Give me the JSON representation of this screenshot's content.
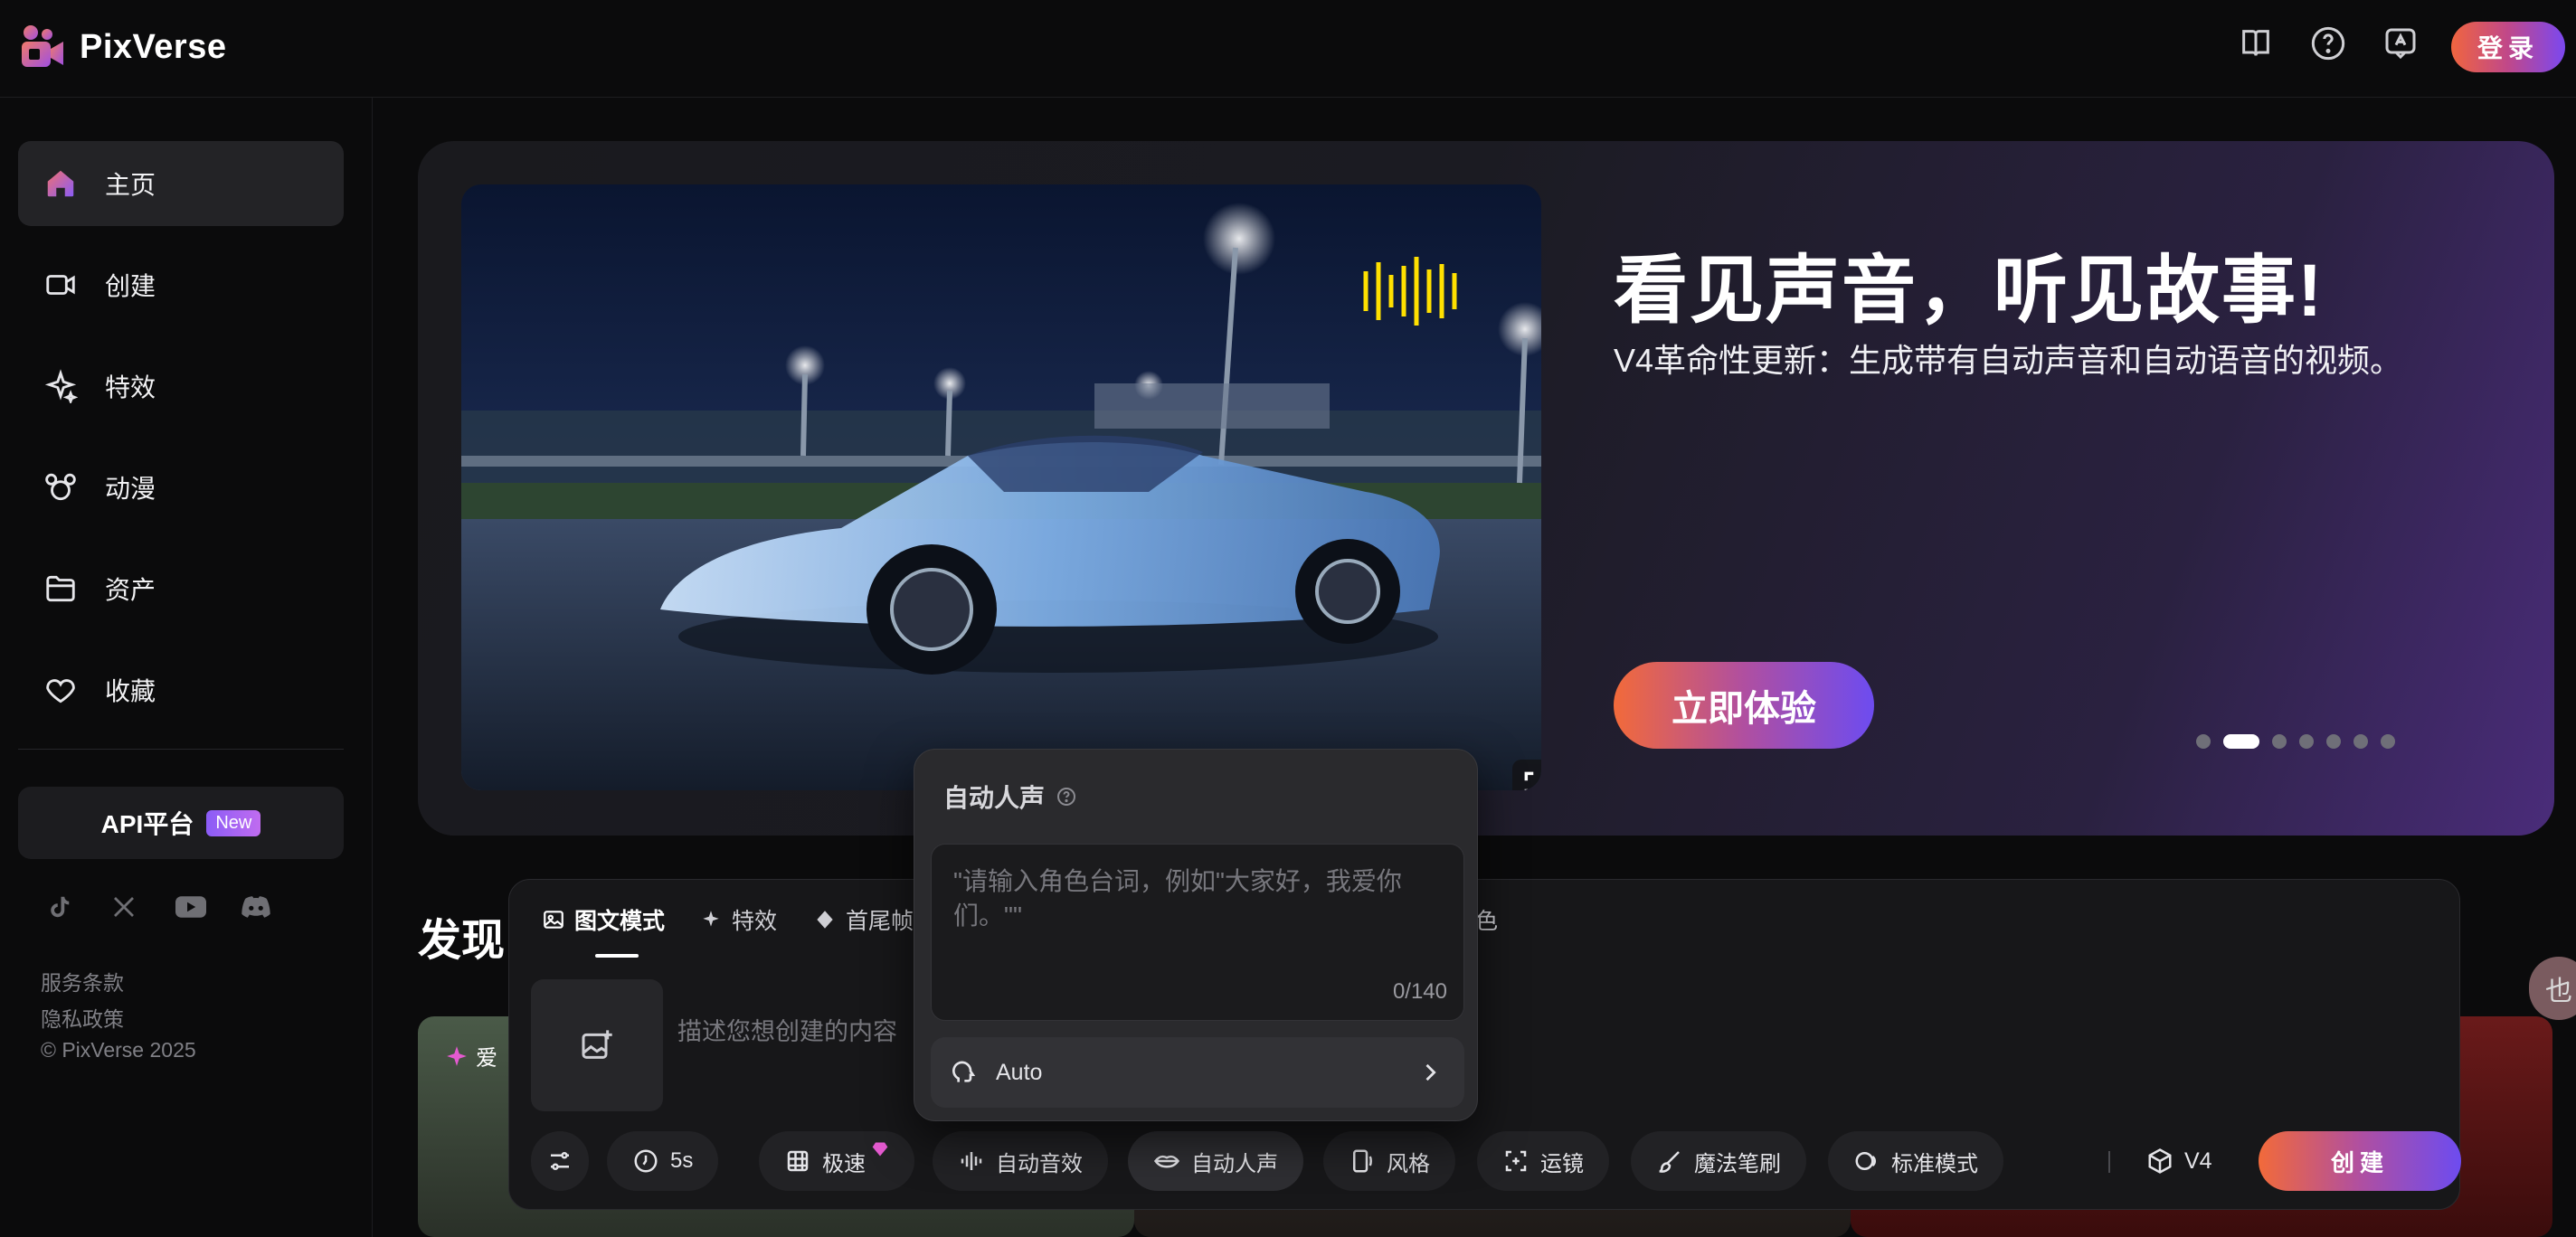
{
  "app": {
    "name": "PixVerse"
  },
  "header": {
    "login_label": "登录"
  },
  "sidebar": {
    "items": [
      {
        "label": "主页",
        "icon": "home-icon"
      },
      {
        "label": "创建",
        "icon": "video-camera-icon"
      },
      {
        "label": "特效",
        "icon": "sparkle-icon"
      },
      {
        "label": "动漫",
        "icon": "mouse-ears-icon"
      },
      {
        "label": "资产",
        "icon": "folder-icon"
      },
      {
        "label": "收藏",
        "icon": "heart-icon"
      }
    ],
    "api_label": "API平台",
    "api_badge": "New",
    "footer": {
      "terms": "服务条款",
      "privacy": "隐私政策",
      "copyright": "© PixVerse 2025"
    }
  },
  "hero": {
    "title": "看见声音，听见故事!",
    "subtitle": "V4革命性更新：生成带有自动声音和自动语音的视频。",
    "cta": "立即体验",
    "active_slide": 2,
    "slide_count": 7
  },
  "discover": {
    "title": "发现",
    "first_card_tag": "爱",
    "side_pill": "也"
  },
  "composer": {
    "tabs": [
      {
        "label": "图文模式",
        "icon": "image-icon"
      },
      {
        "label": "特效",
        "icon": "sparkle-icon"
      },
      {
        "label": "首尾帧",
        "icon": "diamond-icon"
      }
    ],
    "hidden_tab_tail": "色",
    "prompt_placeholder": "描述您想创建的内容",
    "toolbar": {
      "duration": "5s",
      "speed": "极速",
      "auto_sound": "自动音效",
      "auto_voice": "自动人声",
      "style": "风格",
      "camera": "运镜",
      "magic_brush": "魔法笔刷",
      "mode": "标准模式",
      "model": "V4",
      "create": "创建"
    }
  },
  "voice_popup": {
    "title": "自动人声",
    "placeholder": "\"请输入角色台词，例如\"大家好，我爱你们。\"\"",
    "counter": "0/140",
    "voice": "Auto"
  },
  "colors": {
    "accent_start": "#f26a3a",
    "accent_end": "#6d4cf0",
    "background": "#0b0b0c"
  }
}
